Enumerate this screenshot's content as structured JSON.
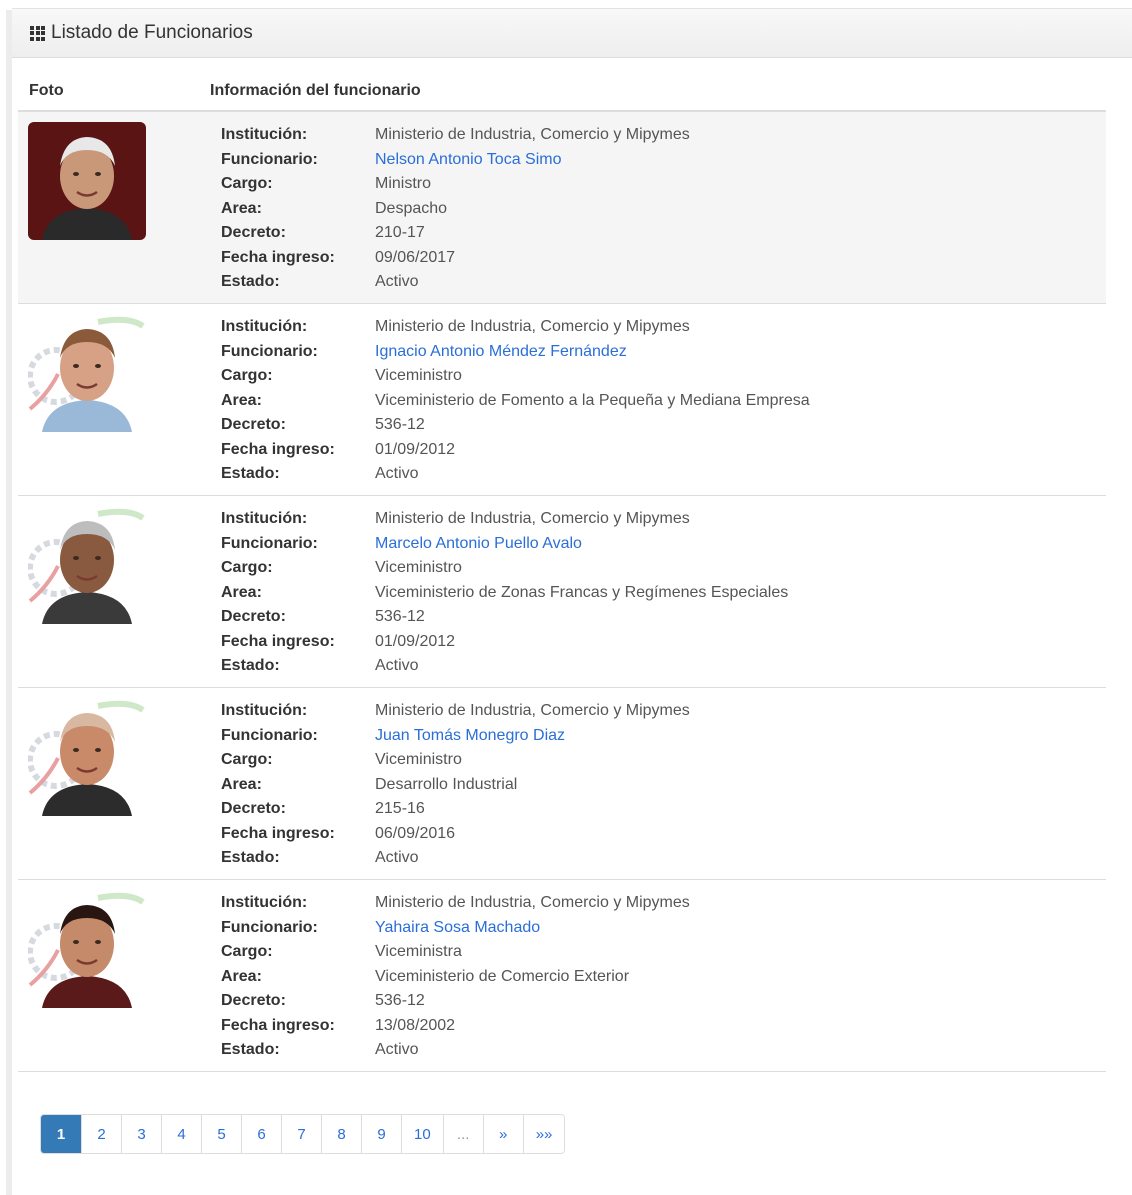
{
  "panel": {
    "title": "Listado de Funcionarios",
    "icon": "grid-icon"
  },
  "table": {
    "headers": {
      "foto": "Foto",
      "info": "Información del funcionario"
    },
    "field_labels": {
      "institucion": "Institución:",
      "funcionario": "Funcionario:",
      "cargo": "Cargo:",
      "area": "Area:",
      "decreto": "Decreto:",
      "fecha": "Fecha ingreso:",
      "estado": "Estado:"
    },
    "rows": [
      {
        "institucion": "Ministerio de Industria, Comercio y Mipymes",
        "funcionario": "Nelson Antonio Toca Simo",
        "cargo": "Ministro",
        "area": "Despacho",
        "decreto": "210-17",
        "fecha": "09/06/2017",
        "estado": "Activo"
      },
      {
        "institucion": "Ministerio de Industria, Comercio y Mipymes",
        "funcionario": "Ignacio Antonio Méndez Fernández",
        "cargo": "Viceministro",
        "area": "Viceministerio de Fomento a la Pequeña y Mediana Empresa",
        "decreto": "536-12",
        "fecha": "01/09/2012",
        "estado": "Activo"
      },
      {
        "institucion": "Ministerio de Industria, Comercio y Mipymes",
        "funcionario": "Marcelo Antonio Puello Avalo",
        "cargo": "Viceministro",
        "area": "Viceministerio de Zonas Francas y Regímenes Especiales",
        "decreto": "536-12",
        "fecha": "01/09/2012",
        "estado": "Activo"
      },
      {
        "institucion": "Ministerio de Industria, Comercio y Mipymes",
        "funcionario": "Juan Tomás Monegro Diaz",
        "cargo": "Viceministro",
        "area": "Desarrollo Industrial",
        "decreto": "215-16",
        "fecha": "06/09/2016",
        "estado": "Activo"
      },
      {
        "institucion": "Ministerio de Industria, Comercio y Mipymes",
        "funcionario": "Yahaira Sosa Machado",
        "cargo": "Viceministra",
        "area": "Viceministerio de Comercio Exterior",
        "decreto": "536-12",
        "fecha": "13/08/2002",
        "estado": "Activo"
      }
    ]
  },
  "pagination": {
    "pages": [
      "1",
      "2",
      "3",
      "4",
      "5",
      "6",
      "7",
      "8",
      "9",
      "10",
      "...",
      "»",
      "»»"
    ],
    "active": "1"
  },
  "colors": {
    "link": "#2a6ed8",
    "active_page": "#337ab7",
    "stripe": "#f5f5f5"
  }
}
